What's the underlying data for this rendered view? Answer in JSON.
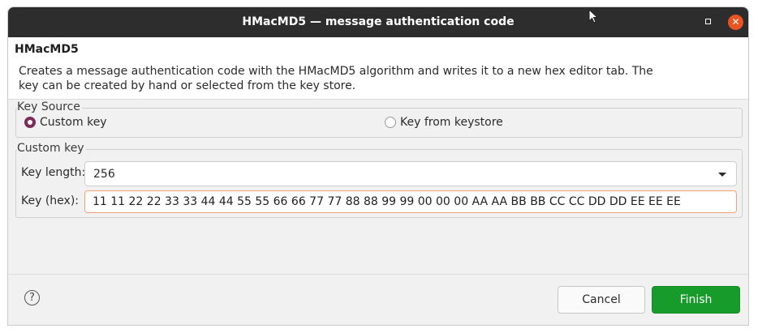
{
  "window": {
    "title": "HMacMD5 — message authentication code",
    "minimize_icon": "square-icon",
    "close_icon": "close-icon",
    "close_glyph": "✕",
    "accent_color": "#e95420"
  },
  "header": {
    "title": "HMacMD5",
    "description": "Creates a message authentication code with the HMacMD5 algorithm and writes it to a new hex editor tab. The key can be created by hand or selected from the key store."
  },
  "key_source": {
    "legend": "Key Source",
    "options": [
      {
        "label": "Custom key",
        "selected": true
      },
      {
        "label": "Key from keystore",
        "selected": false
      }
    ],
    "selected_color": "#7a2e59"
  },
  "custom_key": {
    "legend": "Custom key",
    "key_length_label": "Key length:",
    "key_length_value": "256",
    "key_hex_label": "Key (hex):",
    "key_hex_value": "11 11 22 22 33 33 44 44 55 55 66 66 77 77 88 88 99 99 00 00 00 AA AA BB BB CC CC DD DD EE EE EE"
  },
  "footer": {
    "help_glyph": "?",
    "cancel_label": "Cancel",
    "finish_label": "Finish",
    "finish_color": "#179c2b"
  }
}
